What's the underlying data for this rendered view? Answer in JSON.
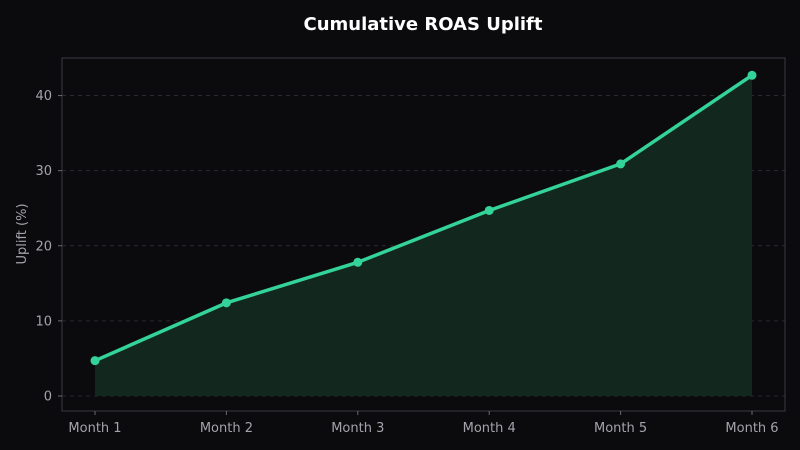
{
  "chart_data": {
    "type": "line",
    "title": "Cumulative ROAS Uplift",
    "xlabel": "",
    "ylabel": "Uplift (%)",
    "categories": [
      "Month 1",
      "Month 2",
      "Month 3",
      "Month 4",
      "Month 5",
      "Month 6"
    ],
    "series": [
      {
        "values": [
          4.7,
          12.4,
          17.8,
          24.7,
          30.9,
          42.7
        ],
        "color": "#34d399"
      }
    ],
    "ylim": [
      -2,
      45
    ],
    "yticks": [
      0,
      10,
      20,
      30,
      40
    ],
    "grid": true,
    "area_fill": true,
    "area_color": "#12281f"
  },
  "colors": {
    "background": "#0b0b0d",
    "accent": "#34d399"
  }
}
